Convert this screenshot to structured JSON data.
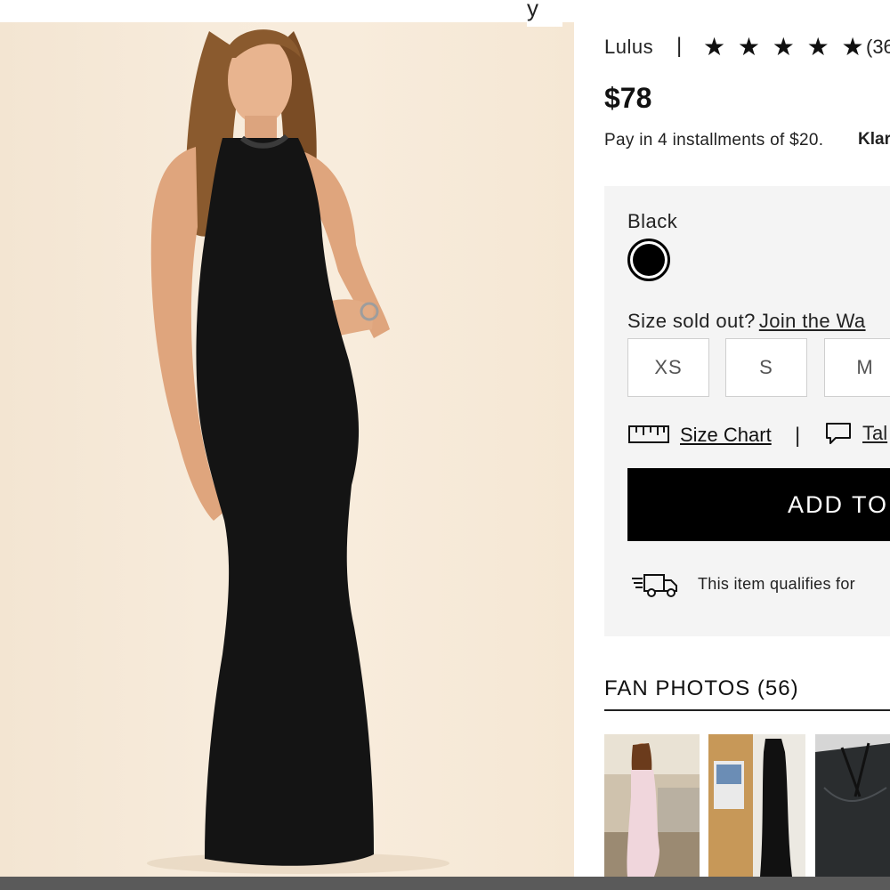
{
  "product": {
    "brand": "Lulus",
    "brand_separator": "|",
    "rating_stars": "★ ★ ★ ★ ★",
    "review_count": "(36",
    "price": "$78",
    "installments_text": "Pay in 4 installments of $20.",
    "installments_provider": "Klar",
    "title_fragment": "y"
  },
  "options": {
    "color_label": "Black",
    "color_value": "#000000",
    "size_prompt": "Size sold out?",
    "size_link": "Join the Wa",
    "sizes": [
      "XS",
      "S",
      "M"
    ],
    "size_chart_label": "Size Chart",
    "separator": "|",
    "talk_link": "Tal",
    "add_to_bag_label": "ADD TO",
    "shipping_text": "This item qualifies for"
  },
  "fan_photos": {
    "title": "FAN PHOTOS (56)"
  },
  "colors": {
    "accent": "#000000",
    "panel_bg": "#f4f4f4",
    "photo_bg": "#f6e9d8"
  }
}
